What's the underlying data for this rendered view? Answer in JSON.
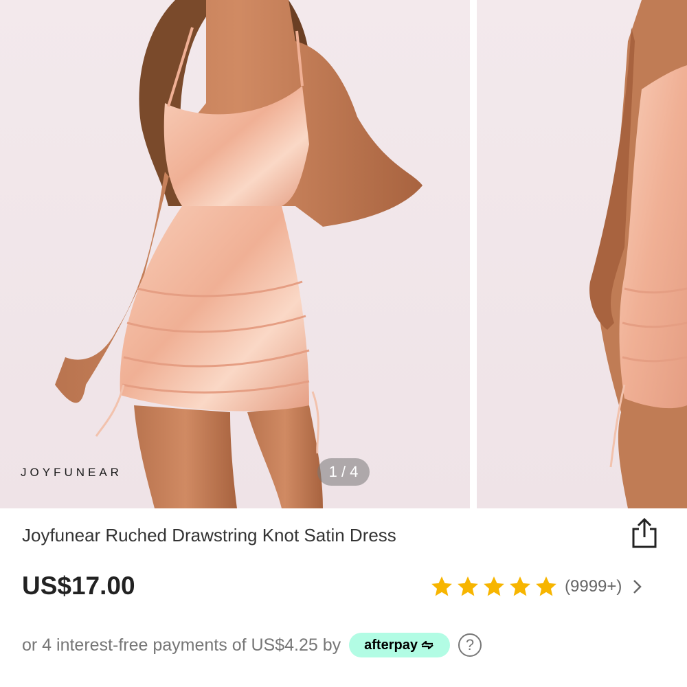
{
  "gallery": {
    "brand_watermark": "JOYFUNEAR",
    "page_indicator": "1 / 4",
    "slides": [
      {
        "alt": "model wearing pink satin dress front view"
      },
      {
        "alt": "model wearing pink satin dress side view"
      }
    ]
  },
  "product": {
    "title": "Joyfunear Ruched Drawstring Knot Satin Dress",
    "price": "US$17.00",
    "rating_stars": 5,
    "review_count": "(9999+)"
  },
  "payment": {
    "installment_text": "or 4 interest-free payments of US$4.25 by",
    "provider_label": "afterpay",
    "help_symbol": "?"
  },
  "icons": {
    "share": "share-icon",
    "star": "star-icon",
    "chevron": "chevron-right-icon",
    "help": "help-icon"
  },
  "colors": {
    "star": "#f7b500",
    "afterpay_bg": "#b2fce4",
    "dress": "#f2b49c",
    "background": "#f1e6e9"
  }
}
